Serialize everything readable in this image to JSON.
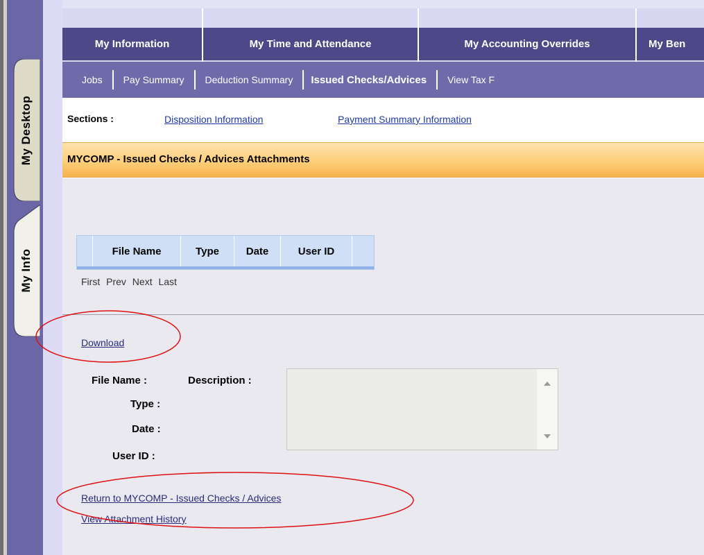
{
  "sidebar": {
    "tabs": [
      {
        "label": "My Desktop"
      },
      {
        "label": "My Info"
      }
    ]
  },
  "main_menu": {
    "items": [
      {
        "label": "My Information"
      },
      {
        "label": "My Time and Attendance"
      },
      {
        "label": "My Accounting Overrides"
      },
      {
        "label": "My Ben"
      }
    ]
  },
  "sub_menu": {
    "items": [
      {
        "label": "Jobs"
      },
      {
        "label": "Pay Summary"
      },
      {
        "label": "Deduction Summary"
      },
      {
        "label": "Issued Checks/Advices"
      },
      {
        "label": "View Tax F"
      }
    ]
  },
  "sections": {
    "label": "Sections :",
    "links": [
      {
        "label": "Disposition Information"
      },
      {
        "label": "Payment Summary Information"
      }
    ]
  },
  "page": {
    "title": "MYCOMP - Issued Checks / Advices Attachments"
  },
  "attachments_table": {
    "columns": [
      "File Name",
      "Type",
      "Date",
      "User ID"
    ],
    "rows": []
  },
  "pager": {
    "first": "First",
    "prev": "Prev",
    "next": "Next",
    "last": "Last"
  },
  "detail": {
    "download_label": "Download",
    "file_name_label": "File Name :",
    "description_label": "Description :",
    "type_label": "Type :",
    "date_label": "Date :",
    "user_id_label": "User ID :",
    "description_value": ""
  },
  "links": {
    "return_label": "Return to MYCOMP - Issued Checks / Advices",
    "history_label": "View Attachment History"
  },
  "colors": {
    "main_menu_bg": "#4d4887",
    "sub_menu_bg": "#6f6bab",
    "sidebar_bg": "#6b66a6",
    "header_orange": "#fecf7a",
    "annotation_red": "#e01010"
  }
}
